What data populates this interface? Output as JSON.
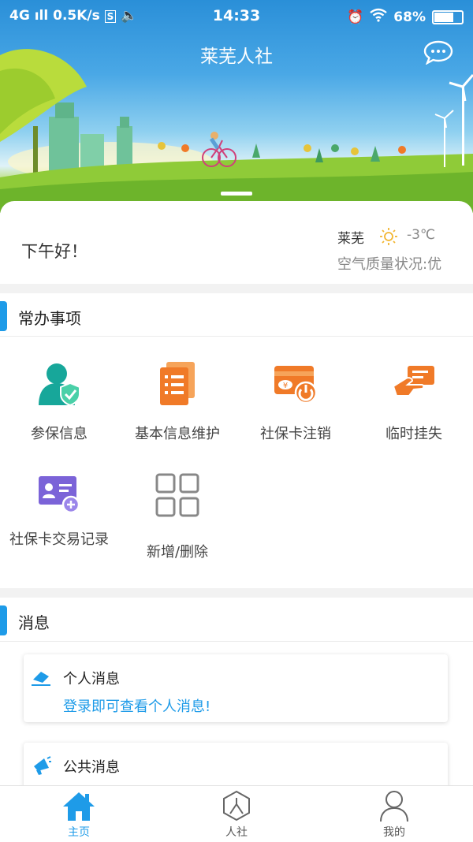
{
  "status_bar": {
    "network": "4G",
    "speed": "0.5K/s",
    "time": "14:33",
    "battery": "68%"
  },
  "header": {
    "title": "莱芜人社",
    "message_icon": "chat-bubble-icon"
  },
  "greeting": {
    "text": "下午好！",
    "city": "莱芜",
    "temperature": "-3℃",
    "air_quality": "空气质量状况:优",
    "weather_icon": "sun-icon"
  },
  "common": {
    "title": "常办事项",
    "items": [
      {
        "label": "参保信息",
        "icon": "user-shield-icon",
        "color": "#17a79a"
      },
      {
        "label": "基本信息维护",
        "icon": "document-list-icon",
        "color": "#f07a28"
      },
      {
        "label": "社保卡注销",
        "icon": "card-power-icon",
        "color": "#f07a28"
      },
      {
        "label": "临时挂失",
        "icon": "hand-card-icon",
        "color": "#f07a28"
      },
      {
        "label": "社保卡交易记录",
        "icon": "id-card-add-icon",
        "color": "#7b63d8"
      },
      {
        "label": "新增/删除",
        "icon": "grid-icon",
        "color": "#888888"
      }
    ]
  },
  "messages": {
    "title": "消息",
    "personal": {
      "title": "个人消息",
      "subtitle": "登录即可查看个人消息!"
    },
    "public": {
      "title": "公共消息"
    }
  },
  "tabbar": {
    "items": [
      {
        "label": "主页",
        "active": true
      },
      {
        "label": "人社",
        "active": false
      },
      {
        "label": "我的",
        "active": false
      }
    ]
  },
  "colors": {
    "accent": "#1e9be8",
    "orange": "#f07a28",
    "teal": "#17a79a",
    "purple": "#7b63d8"
  }
}
